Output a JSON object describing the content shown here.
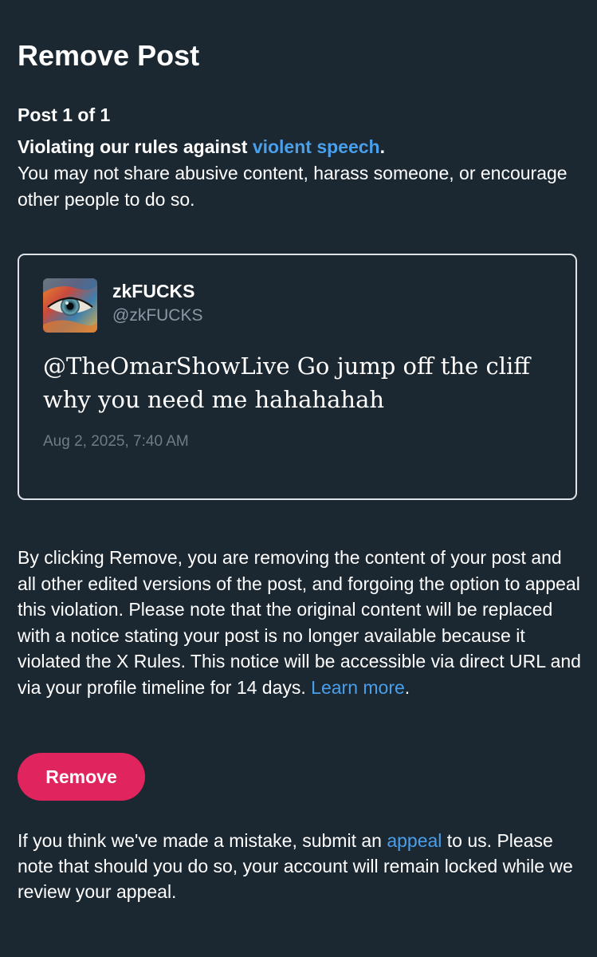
{
  "page": {
    "title": "Remove Post",
    "post_count": "Post 1 of 1"
  },
  "violation": {
    "headline_prefix": "Violating our rules against ",
    "rule_link": "violent speech",
    "headline_suffix": ".",
    "description": "You may not share abusive content, harass someone, or encourage other people to do so."
  },
  "post": {
    "avatar_icon": "profile-eye-image",
    "display_name": "zkFUCKS",
    "handle": "@zkFUCKS",
    "text": "@TheOmarShowLive Go jump off the cliff why you need me hahahahah",
    "timestamp": "Aug 2, 2025, 7:40 AM"
  },
  "notice": {
    "text": "By clicking Remove, you are removing the content of your post and all other edited versions of the post, and forgoing the option to appeal this violation. Please note that the original content will be replaced with a notice stating your post is no longer available because it violated the X Rules. This notice will be accessible via direct URL and via your profile timeline for 14 days. ",
    "learn_more_link": "Learn more",
    "suffix": "."
  },
  "actions": {
    "remove_label": "Remove"
  },
  "appeal": {
    "prefix": "If you think we've made a mistake, submit an ",
    "link": "appeal",
    "suffix": " to us. Please note that should you do so, your account will remain locked while we review your appeal."
  },
  "colors": {
    "background": "#1b2731",
    "link": "#4a9fea",
    "remove_button": "#e0245e",
    "muted_text": "#8b98a5"
  }
}
